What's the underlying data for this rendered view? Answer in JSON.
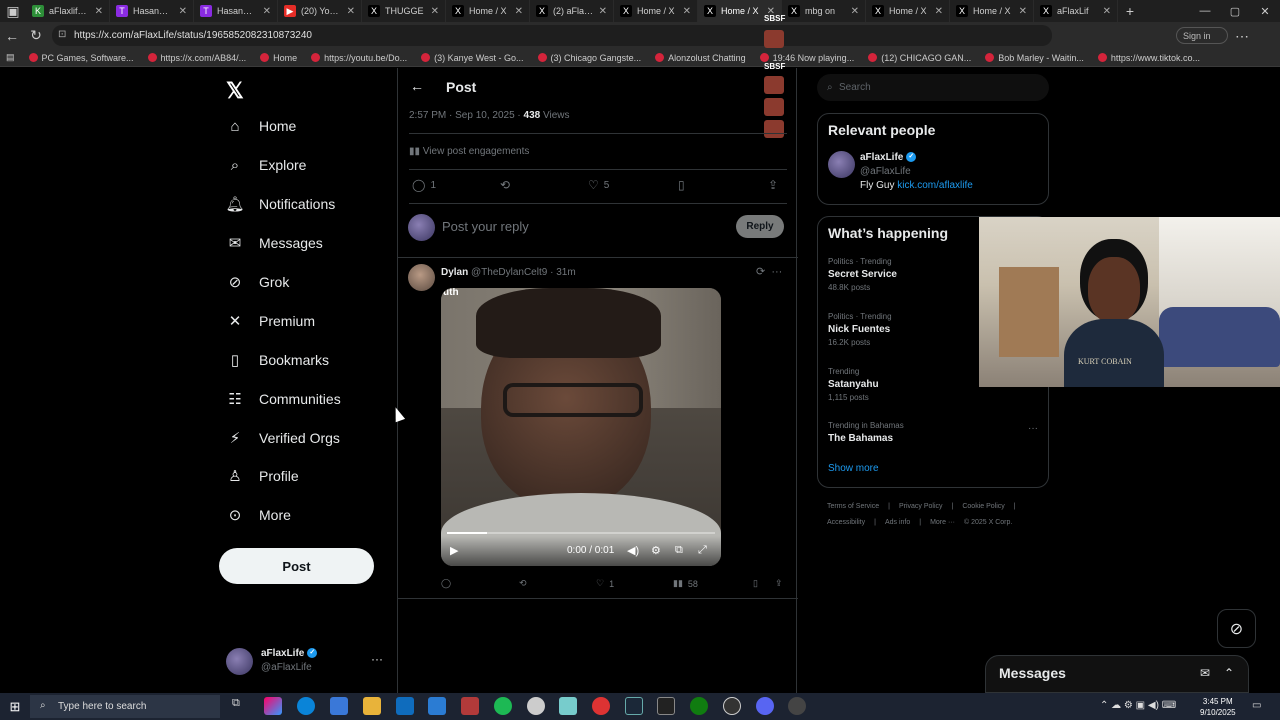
{
  "browser": {
    "tabs": [
      {
        "label": "aFlaxlife Stre",
        "fav_color": "#2d8f38",
        "fav": "K"
      },
      {
        "label": "HasanAbi -",
        "fav_color": "#8a2be2",
        "fav": "T"
      },
      {
        "label": "HasanAbi -",
        "fav_color": "#8a2be2",
        "fav": "T"
      },
      {
        "label": "(20) YouTube",
        "fav_color": "#e52d27",
        "fav": "▶"
      },
      {
        "label": "THUGGE",
        "fav_color": "#000000",
        "fav": "X"
      },
      {
        "label": "Home / X",
        "fav_color": "#000000",
        "fav": "X"
      },
      {
        "label": "(2) aFlaxLife",
        "fav_color": "#000000",
        "fav": "X"
      },
      {
        "label": "Home / X",
        "fav_color": "#000000",
        "fav": "X"
      },
      {
        "label": "Home / X",
        "fav_color": "#000000",
        "fav": "X"
      },
      {
        "label": "mbg on",
        "fav_color": "#000000",
        "fav": "X"
      },
      {
        "label": "Home / X",
        "fav_color": "#000000",
        "fav": "X"
      },
      {
        "label": "Home / X",
        "fav_color": "#000000",
        "fav": "X"
      },
      {
        "label": "aFlaxLif",
        "fav_color": "#000000",
        "fav": "X"
      }
    ],
    "url": "https://x.com/aFlaxLife/status/1965852082310873240",
    "signin": "Sign in",
    "bookmarks": [
      "PC Games, Software...",
      "https://x.com/AB84/...",
      "Home",
      "https://youtu.be/Do...",
      "(3) Kanye West - Go...",
      "(3) Chicago Gangste...",
      "Alonzolust Chatting",
      "19:46 Now playing...",
      "(12) CHICAGO GAN...",
      "Bob Marley - Waitin...",
      "https://www.tiktok.co..."
    ],
    "stream_badge": "SBSF"
  },
  "sidebar": {
    "items": [
      {
        "label": "Home",
        "icon": "⌂"
      },
      {
        "label": "Explore",
        "icon": "⌕"
      },
      {
        "label": "Notifications",
        "icon": "🔔︎"
      },
      {
        "label": "Messages",
        "icon": "✉"
      },
      {
        "label": "Grok",
        "icon": "⊘"
      },
      {
        "label": "Premium",
        "icon": "✕"
      },
      {
        "label": "Bookmarks",
        "icon": "▯"
      },
      {
        "label": "Communities",
        "icon": "☷"
      },
      {
        "label": "Verified Orgs",
        "icon": "⚡︎"
      },
      {
        "label": "Profile",
        "icon": "♙"
      },
      {
        "label": "More",
        "icon": "⊙"
      }
    ],
    "post_label": "Post",
    "account": {
      "name": "aFlaxLife",
      "handle": "@aFlaxLife"
    }
  },
  "main": {
    "title": "Post",
    "meta_time": "2:57 PM · Sep 10, 2025 · ",
    "views_count": "438",
    "views_label": " Views",
    "engagements": "View post engagements",
    "counts": {
      "replies": "1",
      "likes": "5"
    },
    "reply_placeholder": "Post your reply",
    "reply_button": "Reply",
    "reply_tweet": {
      "name": "Dylan",
      "handle_time": "@TheDylanCelt9 · 31m",
      "media_label": "uth",
      "video_time": "0:00 / 0:01",
      "video_progress": 0.15,
      "likes": "1",
      "views": "58"
    }
  },
  "right": {
    "search_placeholder": "Search",
    "relevant_title": "Relevant people",
    "person": {
      "name": "aFlaxLife",
      "handle": "@aFlaxLife",
      "bio_prefix": "Fly Guy ",
      "bio_link": "kick.com/aflaxlife"
    },
    "happening_title": "What’s happening",
    "trends": [
      {
        "context": "Politics · Trending",
        "title": "Secret Service",
        "posts": "48.8K posts"
      },
      {
        "context": "Politics · Trending",
        "title": "Nick Fuentes",
        "posts": "16.2K posts"
      },
      {
        "context": "Trending",
        "title": "Satanyahu",
        "posts": "1,115 posts"
      },
      {
        "context": "Trending in Bahamas",
        "title": "The Bahamas",
        "posts": ""
      }
    ],
    "show_more": "Show more",
    "footer_line1": [
      "Terms of Service",
      "|",
      "Privacy Policy",
      "|",
      "Cookie Policy",
      "|"
    ],
    "footer_line2": [
      "Accessibility",
      "|",
      "Ads info",
      "|",
      "More ···",
      "© 2025 X Corp."
    ],
    "webcam_shirt": "KURT COBAIN",
    "messages_title": "Messages"
  },
  "taskbar": {
    "search_placeholder": "Type here to search",
    "time": "3:45 PM",
    "date": "9/10/2025"
  }
}
